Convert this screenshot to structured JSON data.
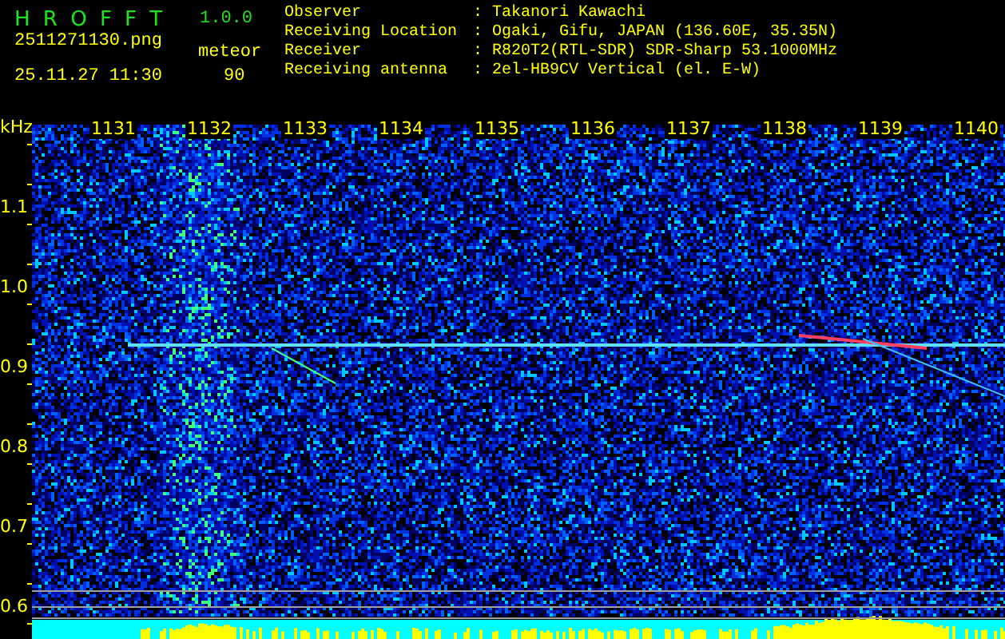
{
  "app": {
    "title": "H R O F F T",
    "version": "1.0.0"
  },
  "file": {
    "name": "2511271130.png",
    "datetime": "25.11.27 11:30"
  },
  "detection": {
    "mode": "meteor",
    "count": "90"
  },
  "station": [
    {
      "label": "Observer",
      "value": ": Takanori Kawachi"
    },
    {
      "label": "Receiving Location",
      "value": ": Ogaki, Gifu, JAPAN (136.60E, 35.35N)"
    },
    {
      "label": "Receiver",
      "value": ": R820T2(RTL-SDR) SDR-Sharp 53.1000MHz"
    },
    {
      "label": "Receiving antenna",
      "value": ": 2el-HB9CV Vertical (el. E-W)"
    }
  ],
  "y_axis": {
    "unit": "kHz",
    "ticks": [
      "1.1",
      "1.0",
      "0.9",
      "0.8",
      "0.7",
      "0.6"
    ]
  },
  "x_axis": {
    "ticks": [
      "1131",
      "1132",
      "1133",
      "1134",
      "1135",
      "1136",
      "1137",
      "1138",
      "1139",
      "1140"
    ]
  }
}
